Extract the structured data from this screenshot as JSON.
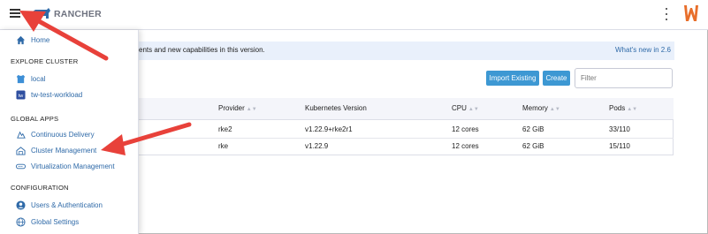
{
  "header": {
    "logo_text": "RANCHER",
    "brand_color": "#e86e2a"
  },
  "sidebar": {
    "home_label": "Home",
    "sections": [
      {
        "title": "EXPLORE CLUSTER",
        "items": [
          {
            "label": "local",
            "icon": "cluster-icon"
          },
          {
            "label": "tw-test-workload",
            "icon": "cluster-icon"
          }
        ]
      },
      {
        "title": "GLOBAL APPS",
        "items": [
          {
            "label": "Continuous Delivery",
            "icon": "fleet-icon"
          },
          {
            "label": "Cluster Management",
            "icon": "cluster-management-icon"
          },
          {
            "label": "Virtualization Management",
            "icon": "harvester-icon"
          }
        ]
      },
      {
        "title": "CONFIGURATION",
        "items": [
          {
            "label": "Users & Authentication",
            "icon": "user-icon"
          },
          {
            "label": "Global Settings",
            "icon": "globe-icon"
          }
        ]
      }
    ]
  },
  "banner": {
    "text": "ents and new capabilities in this version.",
    "link": "What's new in 2.6"
  },
  "toolbar": {
    "import_label": "Import Existing",
    "create_label": "Create",
    "filter_placeholder": "Filter"
  },
  "table": {
    "columns": [
      "Provider",
      "Kubernetes Version",
      "CPU",
      "Memory",
      "Pods"
    ],
    "rows": [
      [
        "rke2",
        "v1.22.9+rke2r1",
        "12 cores",
        "62 GiB",
        "33/110"
      ],
      [
        "rke",
        "v1.22.9",
        "12 cores",
        "62 GiB",
        "15/110"
      ]
    ]
  },
  "colors": {
    "accent": "#3d98d3",
    "link": "#2f6aa8",
    "annotation_arrow": "#e8413a"
  }
}
